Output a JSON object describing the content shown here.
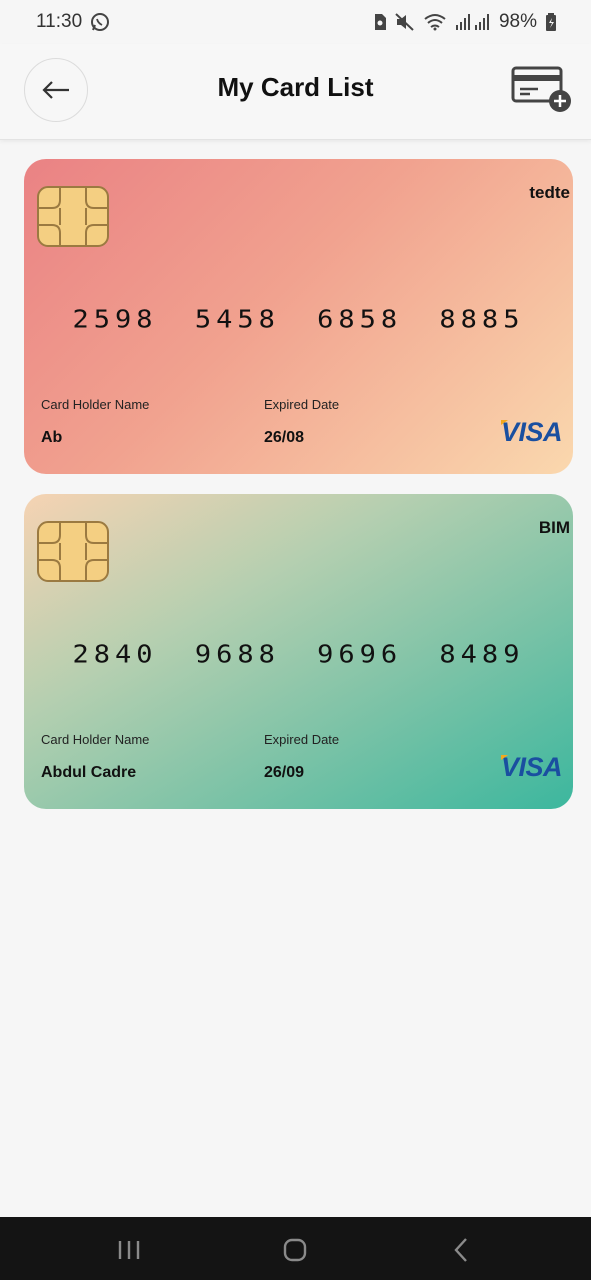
{
  "status_bar": {
    "time": "11:30",
    "battery": "98%",
    "icons": [
      "whatsapp-icon",
      "sim-icon",
      "mute-icon",
      "wifi-icon",
      "signal-icon",
      "battery-icon"
    ]
  },
  "header": {
    "title": "My Card List",
    "back_icon": "arrow-left-icon",
    "add_icon": "add-card-icon"
  },
  "cards": [
    {
      "bank": "tedte",
      "number": [
        "2598",
        "5458",
        "6858",
        "8885"
      ],
      "holder_label": "Card Holder Name",
      "holder_name": "Ab",
      "expiry_label": "Expired Date",
      "expiry": "26/08",
      "network": "VISA",
      "colors": [
        "#ea8284",
        "#fad8ae"
      ]
    },
    {
      "bank": "BIM",
      "number": [
        "2840",
        "9688",
        "9696",
        "8489"
      ],
      "holder_label": "Card Holder Name",
      "holder_name": "Abdul Cadre",
      "expiry_label": "Expired Date",
      "expiry": "26/09",
      "network": "VISA",
      "colors": [
        "#f6d3b3",
        "#3cb79e"
      ]
    }
  ],
  "nav_bar": {
    "icons": [
      "recent-apps-icon",
      "home-icon",
      "back-icon"
    ]
  }
}
